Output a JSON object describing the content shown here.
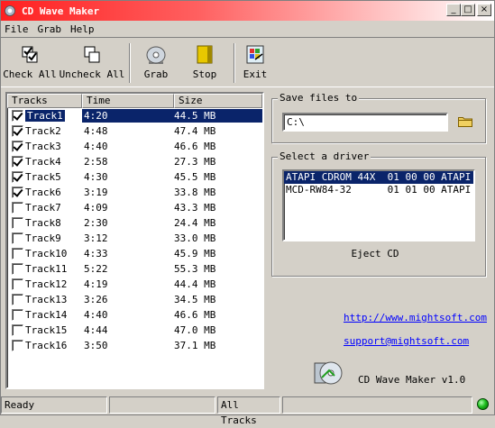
{
  "window": {
    "title": "CD Wave Maker"
  },
  "title_buttons": {
    "minimize": "_",
    "maximize": "□",
    "close": "×"
  },
  "menu": [
    "File",
    "Grab",
    "Help"
  ],
  "toolbar": {
    "check_all": "Check All",
    "uncheck_all": "Uncheck All",
    "grab": "Grab",
    "stop": "Stop",
    "exit": "Exit"
  },
  "tracks": {
    "columns": [
      "Tracks",
      "Time",
      "Size"
    ],
    "rows": [
      {
        "name": "Track1",
        "time": "4:20",
        "size": "44.5 MB",
        "checked": true,
        "selected": true
      },
      {
        "name": "Track2",
        "time": "4:48",
        "size": "47.4 MB",
        "checked": true
      },
      {
        "name": "Track3",
        "time": "4:40",
        "size": "46.6 MB",
        "checked": true
      },
      {
        "name": "Track4",
        "time": "2:58",
        "size": "27.3 MB",
        "checked": true
      },
      {
        "name": "Track5",
        "time": "4:30",
        "size": "45.5 MB",
        "checked": true
      },
      {
        "name": "Track6",
        "time": "3:19",
        "size": "33.8 MB",
        "checked": true
      },
      {
        "name": "Track7",
        "time": "4:09",
        "size": "43.3 MB",
        "checked": false
      },
      {
        "name": "Track8",
        "time": "2:30",
        "size": "24.4 MB",
        "checked": false
      },
      {
        "name": "Track9",
        "time": "3:12",
        "size": "33.0 MB",
        "checked": false
      },
      {
        "name": "Track10",
        "time": "4:33",
        "size": "45.9 MB",
        "checked": false
      },
      {
        "name": "Track11",
        "time": "5:22",
        "size": "55.3 MB",
        "checked": false
      },
      {
        "name": "Track12",
        "time": "4:19",
        "size": "44.4 MB",
        "checked": false
      },
      {
        "name": "Track13",
        "time": "3:26",
        "size": "34.5 MB",
        "checked": false
      },
      {
        "name": "Track14",
        "time": "4:40",
        "size": "46.6 MB",
        "checked": false
      },
      {
        "name": "Track15",
        "time": "4:44",
        "size": "47.0 MB",
        "checked": false
      },
      {
        "name": "Track16",
        "time": "3:50",
        "size": "37.1 MB",
        "checked": false
      }
    ]
  },
  "save": {
    "legend": "Save files to",
    "path": "C:\\"
  },
  "driver": {
    "legend": "Select a driver",
    "items": [
      "ATAPI CDROM 44X  01 00 00 ATAPI",
      "MCD-RW84-32      01 01 00 ATAPI"
    ],
    "eject": "Eject CD"
  },
  "links": {
    "website": "http://www.mightsoft.com",
    "support": "support@mightsoft.com"
  },
  "about": "CD Wave Maker v1.0",
  "status": {
    "left": "Ready",
    "middle": "",
    "tracks": "All Tracks",
    "right": ""
  }
}
